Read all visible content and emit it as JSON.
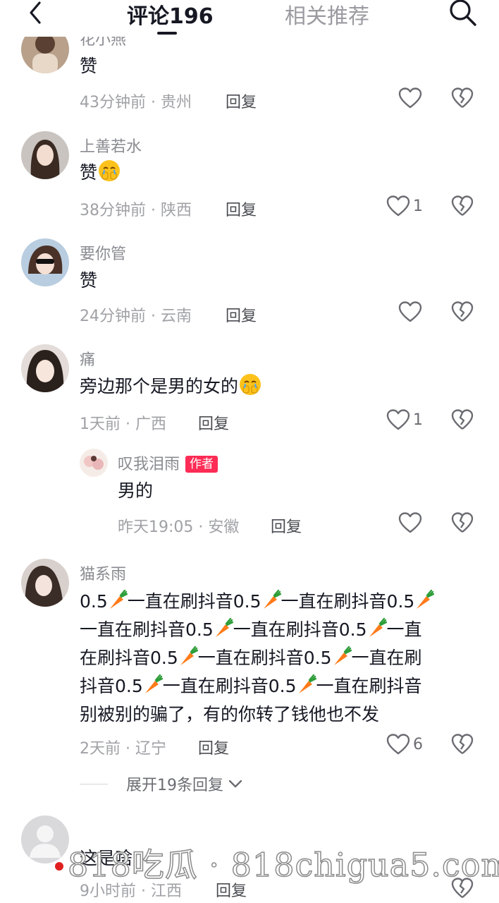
{
  "header": {
    "tab_comments": "评论196",
    "tab_related": "相关推荐",
    "back_icon": "chevron-left-icon",
    "search_icon": "search-icon"
  },
  "comments": [
    {
      "username": "花小燕",
      "text": "赞",
      "time": "43分钟前",
      "location": "贵州",
      "reply": "回复",
      "likes": ""
    },
    {
      "username": "上善若水",
      "text": "赞",
      "time": "38分钟前",
      "location": "陕西",
      "reply": "回复",
      "likes": "1"
    },
    {
      "username": "要你管",
      "text": "赞",
      "time": "24分钟前",
      "location": "云南",
      "reply": "回复",
      "likes": ""
    },
    {
      "username": "痛",
      "text": "旁边那个是男的女的",
      "time": "1天前",
      "location": "广西",
      "reply": "回复",
      "likes": "1"
    },
    {
      "username": "叹我泪雨",
      "badge": "作者",
      "text": "男的",
      "time": "昨天19:05",
      "location": "安徽",
      "reply": "回复",
      "likes": ""
    },
    {
      "username": "猫系雨",
      "lines": [
        "0.5",
        "一直在刷抖音0.5",
        "一直在刷抖音0.5",
        "一直在刷抖音0.5",
        "一直在刷抖音0.5",
        "一直",
        "在刷抖音0.5",
        "一直在刷抖音0.5",
        "一直在刷",
        "抖音0.5",
        "一直在刷抖音0.5",
        "一直在刷抖音",
        "别被别的骗了，有的你转了钱他也不发"
      ],
      "time": "2天前",
      "location": "辽宁",
      "reply": "回复",
      "likes": "6"
    },
    {
      "username": "",
      "text": "这是啥",
      "time": "9小时前",
      "location": "江西",
      "reply": "回复",
      "likes": ""
    }
  ],
  "expand_replies": "展开19条回复",
  "separator": "·",
  "watermark": "818吃瓜 · 818chigua5.com",
  "colors": {
    "author_badge": "#fe2c55",
    "meta": "#a0a1a6",
    "text": "#161823"
  }
}
